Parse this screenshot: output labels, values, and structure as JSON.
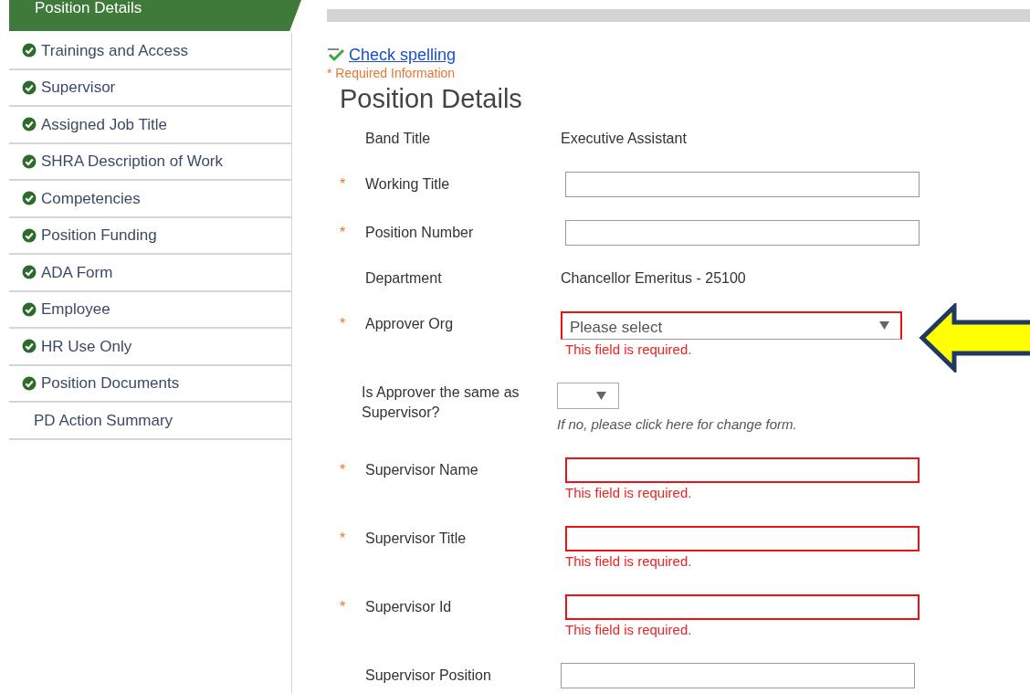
{
  "sidebar": {
    "items": [
      {
        "label": "Position Details",
        "selected": true,
        "completed": false
      },
      {
        "label": "Trainings and Access",
        "selected": false,
        "completed": true
      },
      {
        "label": "Supervisor",
        "selected": false,
        "completed": true
      },
      {
        "label": "Assigned Job Title",
        "selected": false,
        "completed": true
      },
      {
        "label": "SHRA Description of Work",
        "selected": false,
        "completed": true
      },
      {
        "label": "Competencies",
        "selected": false,
        "completed": true
      },
      {
        "label": "Position Funding",
        "selected": false,
        "completed": true
      },
      {
        "label": "ADA Form",
        "selected": false,
        "completed": true
      },
      {
        "label": "Employee",
        "selected": false,
        "completed": true
      },
      {
        "label": "HR Use Only",
        "selected": false,
        "completed": true
      },
      {
        "label": "Position Documents",
        "selected": false,
        "completed": true
      },
      {
        "label": "PD Action Summary",
        "selected": false,
        "completed": false
      }
    ]
  },
  "spellcheck_link": "Check spelling",
  "required_note": "* Required Information",
  "title": "Position Details",
  "fields": [
    {
      "kind": "text",
      "label": "Band Title",
      "value": "Executive Assistant"
    },
    {
      "kind": "input",
      "required_mark": "*",
      "label": "Working Title"
    },
    {
      "kind": "input",
      "required_mark": "*",
      "label": "Position Number"
    },
    {
      "kind": "text",
      "label": "Department",
      "value": "Chancellor Emeritus - 25100"
    },
    {
      "kind": "select",
      "required_mark": "*",
      "label": "Approver Org",
      "value": "Please select",
      "error": "This field is required."
    },
    {
      "kind": "small-select",
      "label": "Is Approver the same as Supervisor?",
      "note": "If no, please click here for change form."
    },
    {
      "kind": "input",
      "required_mark": "*",
      "label": "Supervisor Name",
      "error": "This field is required."
    },
    {
      "kind": "input",
      "required_mark": "*",
      "label": "Supervisor Title",
      "error": "This field is required."
    },
    {
      "kind": "input",
      "required_mark": "*",
      "label": "Supervisor Id",
      "error": "This field is required."
    },
    {
      "kind": "input",
      "label": "Supervisor Position"
    }
  ]
}
